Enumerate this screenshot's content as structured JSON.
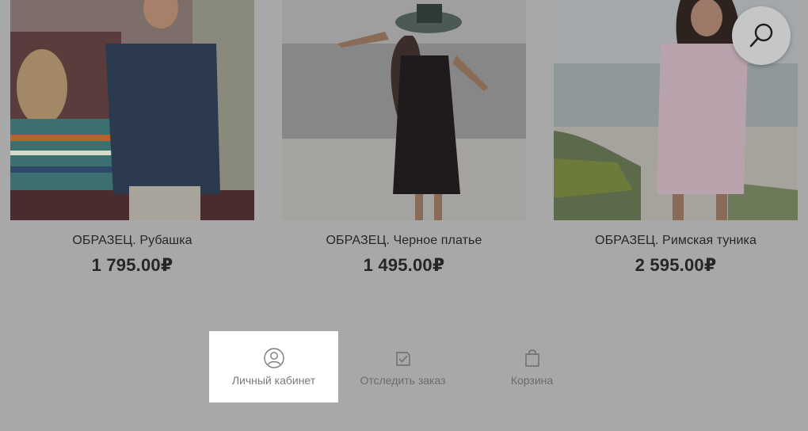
{
  "products": [
    {
      "name": "ОБРАЗЕЦ. Рубашка",
      "price": "1 795.00₽"
    },
    {
      "name": "ОБРАЗЕЦ. Черное платье",
      "price": "1 495.00₽"
    },
    {
      "name": "ОБРАЗЕЦ. Римская туника",
      "price": "2 595.00₽"
    }
  ],
  "bottom_nav": [
    {
      "label": "Личный кабинет",
      "icon": "user-circle-icon",
      "active": true
    },
    {
      "label": "Отследить заказ",
      "icon": "order-check-icon",
      "active": false
    },
    {
      "label": "Корзина",
      "icon": "shopping-bag-icon",
      "active": false
    }
  ],
  "search": {
    "icon": "search-icon"
  },
  "colors": {
    "overlay": "#a8a8a8",
    "active_tab": "#ffffff",
    "text": "#262626"
  }
}
